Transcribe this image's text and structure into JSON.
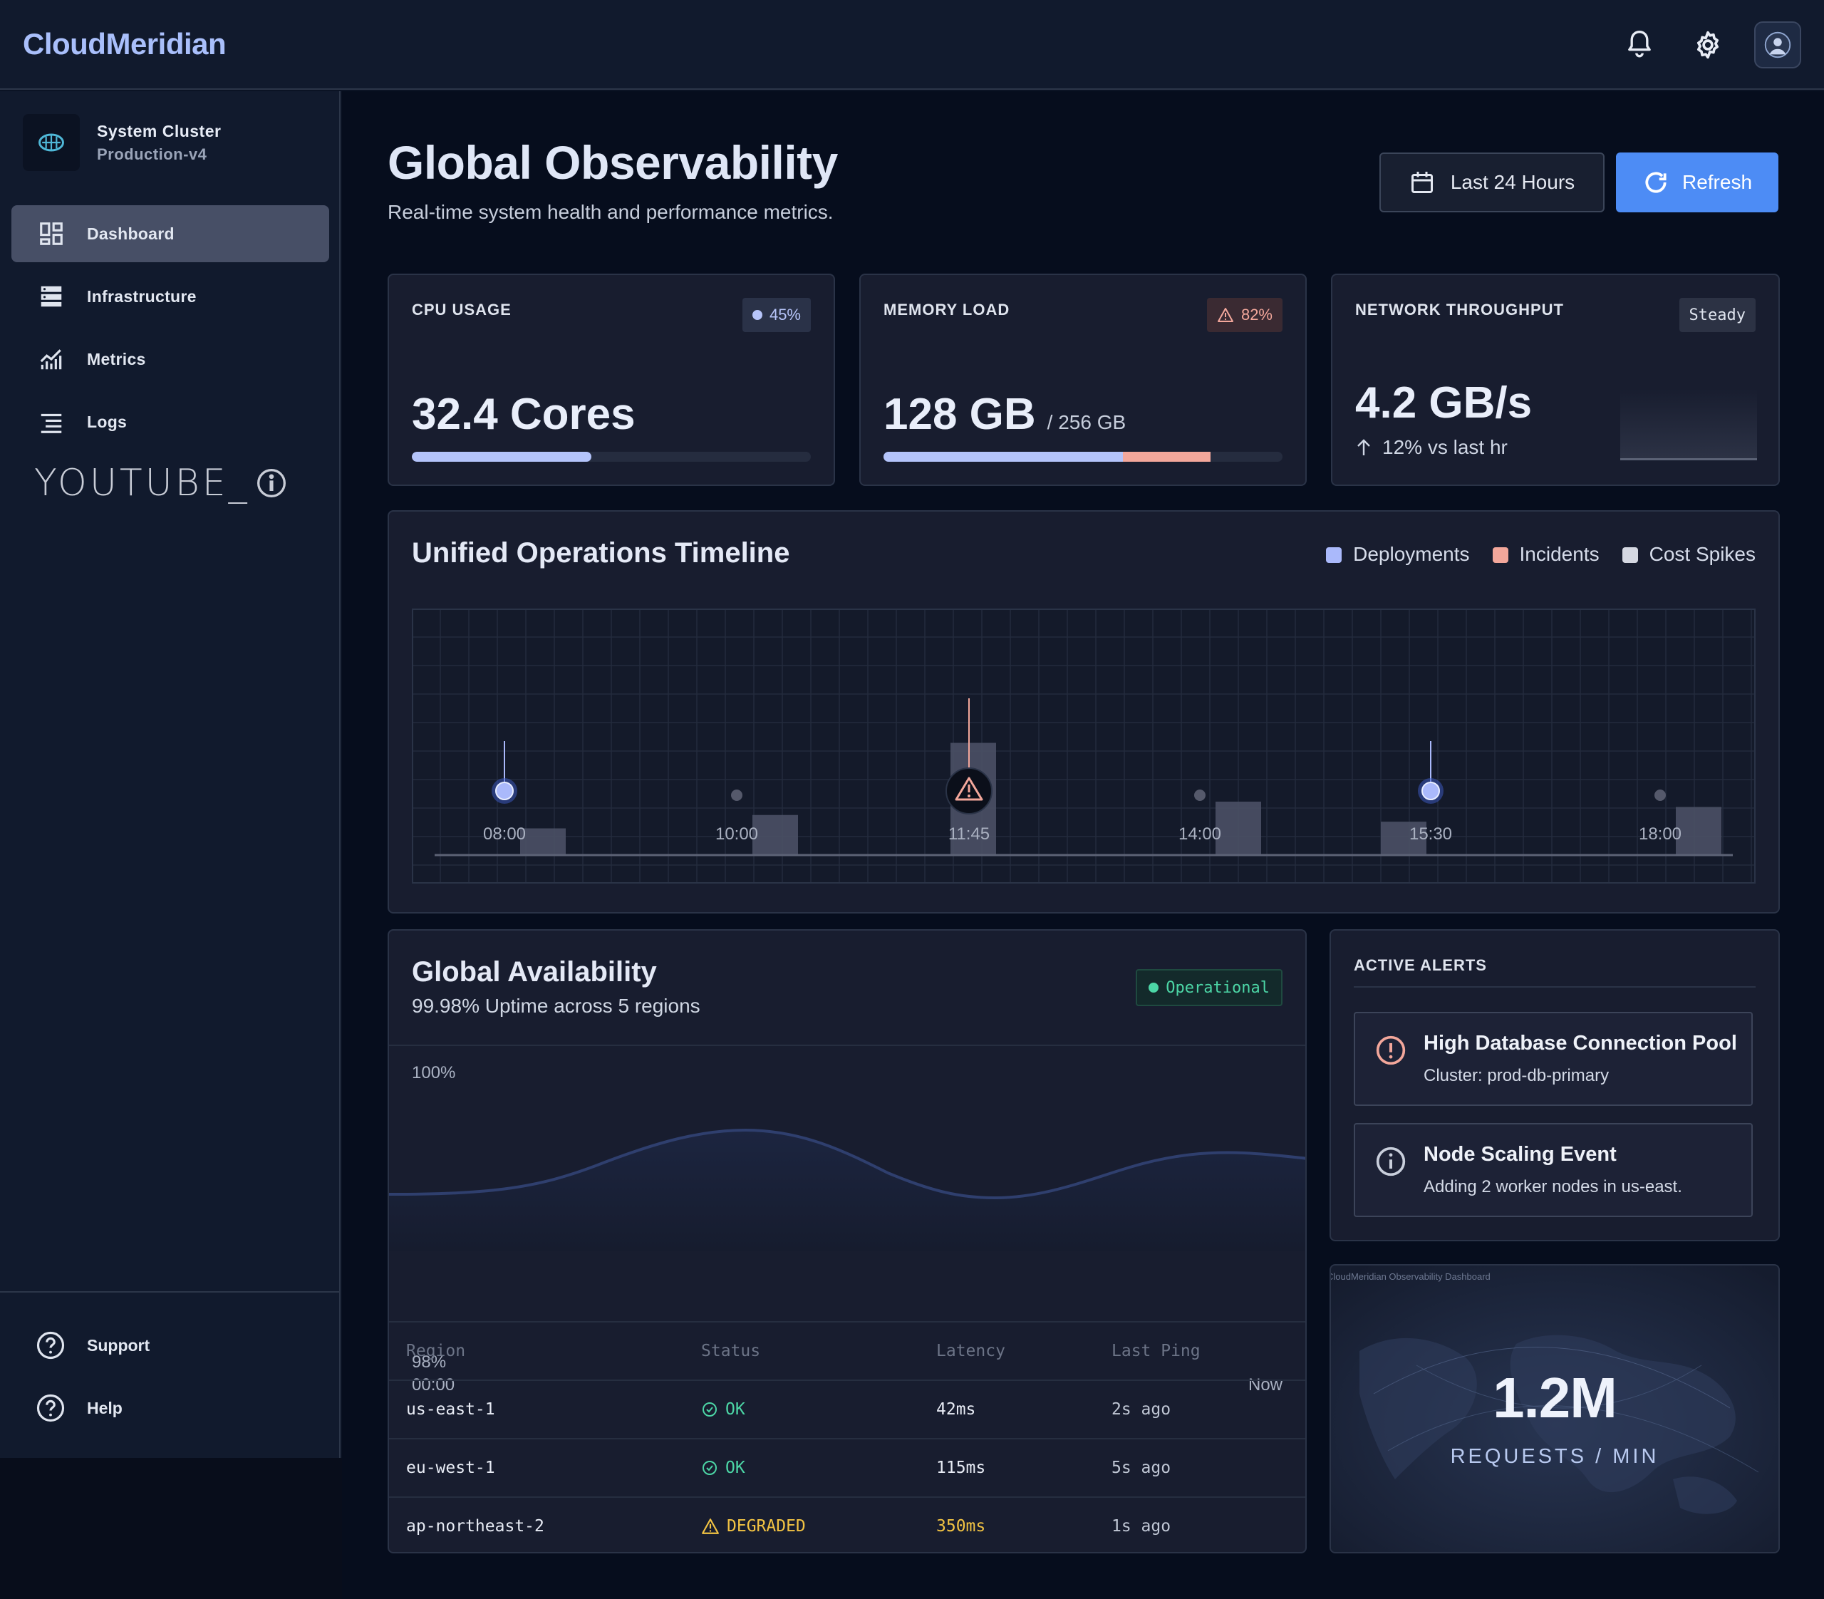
{
  "app": {
    "brand": "CloudMeridian"
  },
  "cluster": {
    "name": "System Cluster",
    "env": "Production-v4"
  },
  "nav": [
    {
      "label": "Dashboard",
      "icon": "dashboard-icon",
      "active": true
    },
    {
      "label": "Infrastructure",
      "icon": "server-icon"
    },
    {
      "label": "Metrics",
      "icon": "chart-icon"
    },
    {
      "label": "Logs",
      "icon": "list-icon"
    }
  ],
  "watermark": {
    "text": "YOUTUBE_"
  },
  "footer_nav": [
    {
      "label": "Support",
      "icon": "help-icon"
    },
    {
      "label": "Help",
      "icon": "help-icon"
    }
  ],
  "header": {
    "title": "Global Observability",
    "subtitle": "Real-time system health and performance metrics.",
    "range_label": "Last 24 Hours",
    "refresh_label": "Refresh"
  },
  "kpis": {
    "cpu": {
      "label": "CPU USAGE",
      "badge": "45%",
      "value": "32.4 Cores",
      "progress": 0.45
    },
    "memory": {
      "label": "MEMORY LOAD",
      "badge": "82%",
      "value": "128 GB",
      "suffix": "/ 256 GB",
      "progress_primary": 0.6,
      "progress_warning": 0.22
    },
    "network": {
      "label": "NETWORK THROUGHPUT",
      "badge": "Steady",
      "value": "4.2 GB/s",
      "delta": "12% vs last hr"
    }
  },
  "timeline": {
    "title": "Unified Operations Timeline",
    "legend": [
      "Deployments",
      "Incidents",
      "Cost Spikes"
    ],
    "colors": {
      "deploy": "#aab9fb",
      "incident": "#f3a79b",
      "cost": "#d5d8e2"
    }
  },
  "chart_data": {
    "type": "bar",
    "categories": [
      "08:00",
      "10:00",
      "11:45",
      "14:00",
      "15:30",
      "18:00"
    ],
    "values": [
      1.0,
      1.5,
      4.2,
      2.0,
      1.25,
      1.8
    ],
    "events": [
      "deployment",
      "none",
      "incident",
      "none",
      "deployment",
      "none"
    ],
    "xlabel": "",
    "ylabel": ""
  },
  "availability": {
    "title": "Global Availability",
    "subtitle": "99.98% Uptime across 5 regions",
    "status": "Operational",
    "y_top": "100%",
    "y_bottom": "98%",
    "x_start": "00:00",
    "x_end": "Now",
    "columns": [
      "Region",
      "Status",
      "Latency",
      "Last Ping"
    ],
    "rows": [
      {
        "region": "us-east-1",
        "status": "OK",
        "latency": "42ms",
        "ping": "2s ago",
        "state": "ok"
      },
      {
        "region": "eu-west-1",
        "status": "OK",
        "latency": "115ms",
        "ping": "5s ago",
        "state": "ok"
      },
      {
        "region": "ap-northeast-2",
        "status": "DEGRADED",
        "latency": "350ms",
        "ping": "1s ago",
        "state": "warn"
      }
    ]
  },
  "alerts": {
    "label": "ACTIVE ALERTS",
    "items": [
      {
        "title": "High Database Connection Pool",
        "detail": "Cluster: prod-db-primary",
        "icon": "alert-circle-icon"
      },
      {
        "title": "Node Scaling Event",
        "detail": "Adding 2 worker nodes in us-east.",
        "icon": "info-circle-icon"
      }
    ]
  },
  "requests": {
    "value": "1.2M",
    "label": "REQUESTS / MIN",
    "caption": "CloudMeridian Observability Dashboard"
  }
}
